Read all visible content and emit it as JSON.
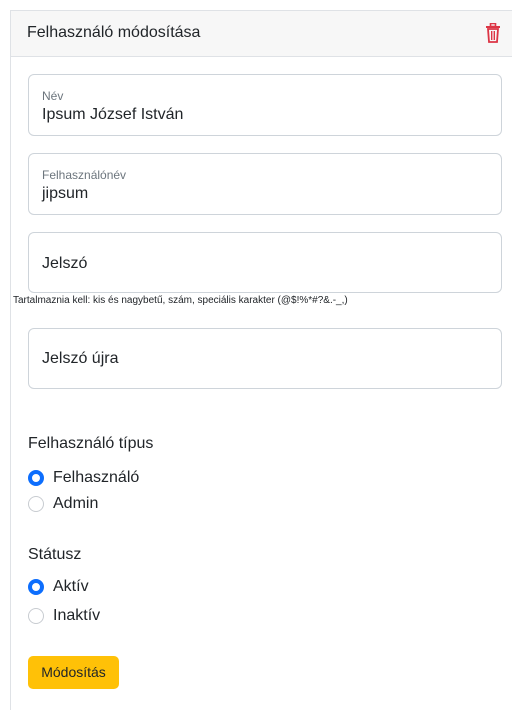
{
  "card": {
    "title": "Felhasználó módosítása",
    "delete_icon": "trash-icon",
    "accent_color": "#dc3545"
  },
  "form": {
    "name": {
      "label": "Név",
      "value": "Ipsum József István"
    },
    "username": {
      "label": "Felhasználónév",
      "value": "jipsum"
    },
    "password": {
      "placeholder": "Jelszó"
    },
    "password_hint": "Tartalmaznia kell: kis és nagybetű, szám, speciális karakter (@$!%*#?&.-_,)",
    "password_confirm": {
      "placeholder": "Jelszó újra"
    },
    "user_type": {
      "title": "Felhasználó típus",
      "options": [
        {
          "label": "Felhasználó",
          "checked": true
        },
        {
          "label": "Admin",
          "checked": false
        }
      ]
    },
    "status": {
      "title": "Státusz",
      "options": [
        {
          "label": "Aktív",
          "checked": true
        },
        {
          "label": "Inaktív",
          "checked": false
        }
      ]
    },
    "submit_label": "Módosítás",
    "submit_color": "#ffc107",
    "radio_color": "#0d6efd"
  }
}
